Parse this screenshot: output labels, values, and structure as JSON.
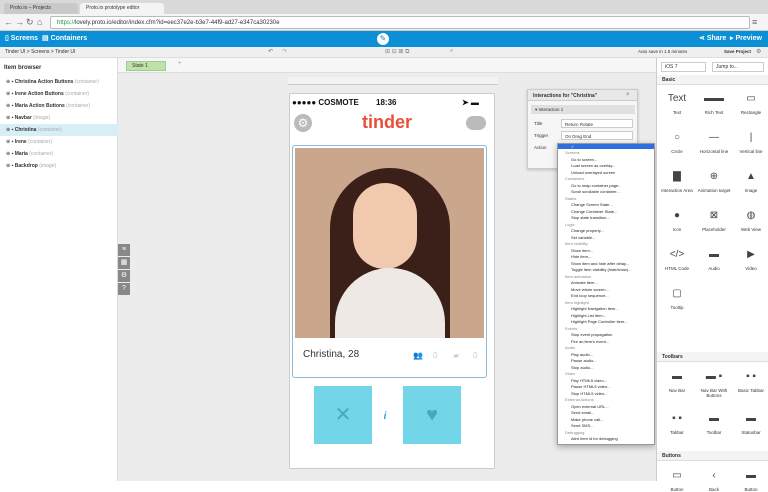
{
  "browser": {
    "tabs": [
      {
        "label": "Proto.io – Projects"
      },
      {
        "label": "Proto.io prototype editor"
      }
    ],
    "url_prefix": "https://",
    "url_rest": "lovely.proto.io/editor/index.cfm?id=eec37e2e-b3e7-44f9-ad27-e347ca30230e"
  },
  "app": {
    "screens_label": "Screens",
    "containers_label": "Containers",
    "share_label": "Share",
    "preview_label": "Preview",
    "breadcrumb": "Tinder UI > Screens > Tinder UI",
    "autosave": "Auto save in 1.5 minutes",
    "save_label": "Save Project"
  },
  "state": {
    "label": "State 1"
  },
  "item_browser": {
    "title": "Item browser",
    "items": [
      {
        "name": "Christina Action Buttons",
        "type": "(container)"
      },
      {
        "name": "Irene Action Buttons",
        "type": "(container)"
      },
      {
        "name": "Maria Action Buttons",
        "type": "(container)"
      },
      {
        "name": "Navbar",
        "type": "(image)"
      },
      {
        "name": "Christina",
        "type": "(container)"
      },
      {
        "name": "Irene",
        "type": "(container)"
      },
      {
        "name": "Maria",
        "type": "(container)"
      },
      {
        "name": "Backdrop",
        "type": "(image)"
      }
    ]
  },
  "phone": {
    "carrier": "●●●●● COSMOTE",
    "time": "18:36",
    "logo": "tinder",
    "name": "Christina, 28",
    "friends": "0",
    "interests": "0"
  },
  "interactions": {
    "title": "Interactions for \"Christina\"",
    "sub": "Interaction 1",
    "title_label": "Title",
    "title_value": "Return Rotate",
    "trigger_label": "Trigger",
    "trigger_value": "On Drag End",
    "action_label": "Action"
  },
  "dropdown": [
    {
      "t": "Screens",
      "g": true
    },
    {
      "t": "Go to screen..."
    },
    {
      "t": "Load screen as overlay..."
    },
    {
      "t": "Unload overlayed screen"
    },
    {
      "t": "Containers",
      "g": true
    },
    {
      "t": "Go to snap container page..."
    },
    {
      "t": "Scroll scrollable container..."
    },
    {
      "t": "States",
      "g": true
    },
    {
      "t": "Change Screen State..."
    },
    {
      "t": "Change Container State..."
    },
    {
      "t": "Stop state transition..."
    },
    {
      "t": "Logic",
      "g": true
    },
    {
      "t": "Change property..."
    },
    {
      "t": "Set variable..."
    },
    {
      "t": "Item visibility",
      "g": true
    },
    {
      "t": "Show item..."
    },
    {
      "t": "Hide item..."
    },
    {
      "t": "Show item and hide after delay..."
    },
    {
      "t": "Toggle item visibility (hide/show)..."
    },
    {
      "t": "Item animation",
      "g": true
    },
    {
      "t": "Animate item..."
    },
    {
      "t": "Move whole screen..."
    },
    {
      "t": "End loop sequence..."
    },
    {
      "t": "Item highlight",
      "g": true
    },
    {
      "t": "Highlight Navigation item..."
    },
    {
      "t": "Highlight List item..."
    },
    {
      "t": "Highlight Page Controller item..."
    },
    {
      "t": "Events",
      "g": true
    },
    {
      "t": "Stop event propagation"
    },
    {
      "t": "Fire an item's event..."
    },
    {
      "t": "Audio",
      "g": true
    },
    {
      "t": "Play audio..."
    },
    {
      "t": "Pause audio..."
    },
    {
      "t": "Stop audio..."
    },
    {
      "t": "Video",
      "g": true
    },
    {
      "t": "Play HTML5 video..."
    },
    {
      "t": "Pause HTML5 video..."
    },
    {
      "t": "Stop HTML5 video..."
    },
    {
      "t": "External Actions",
      "g": true
    },
    {
      "t": "Open external URL..."
    },
    {
      "t": "Send email..."
    },
    {
      "t": "Make phone call..."
    },
    {
      "t": "Send SMS..."
    },
    {
      "t": "Debugging",
      "g": true
    },
    {
      "t": "Alert item id for debugging"
    },
    {
      "t": "Alert variable for debugging"
    }
  ],
  "library": {
    "device": "iOS 7",
    "jump": "Jump to...",
    "basic_label": "Basic",
    "basic": [
      "Text",
      "Rich Text",
      "Rectangle",
      "Circle",
      "Horizontal line",
      "Vertical line",
      "Interaction Area",
      "Animation target",
      "Image",
      "Icon",
      "Placeholder",
      "Web View",
      "HTML Code",
      "Audio",
      "Video",
      "Tooltip"
    ],
    "toolbars_label": "Toolbars",
    "toolbars": [
      "Nav Bar",
      "Nav Bar With Buttons",
      "Basic Tabbar",
      "Tabbar",
      "Toolbar",
      "Statusbar"
    ],
    "buttons_label": "Buttons",
    "buttons": [
      "Button",
      "Back",
      "Button"
    ]
  }
}
